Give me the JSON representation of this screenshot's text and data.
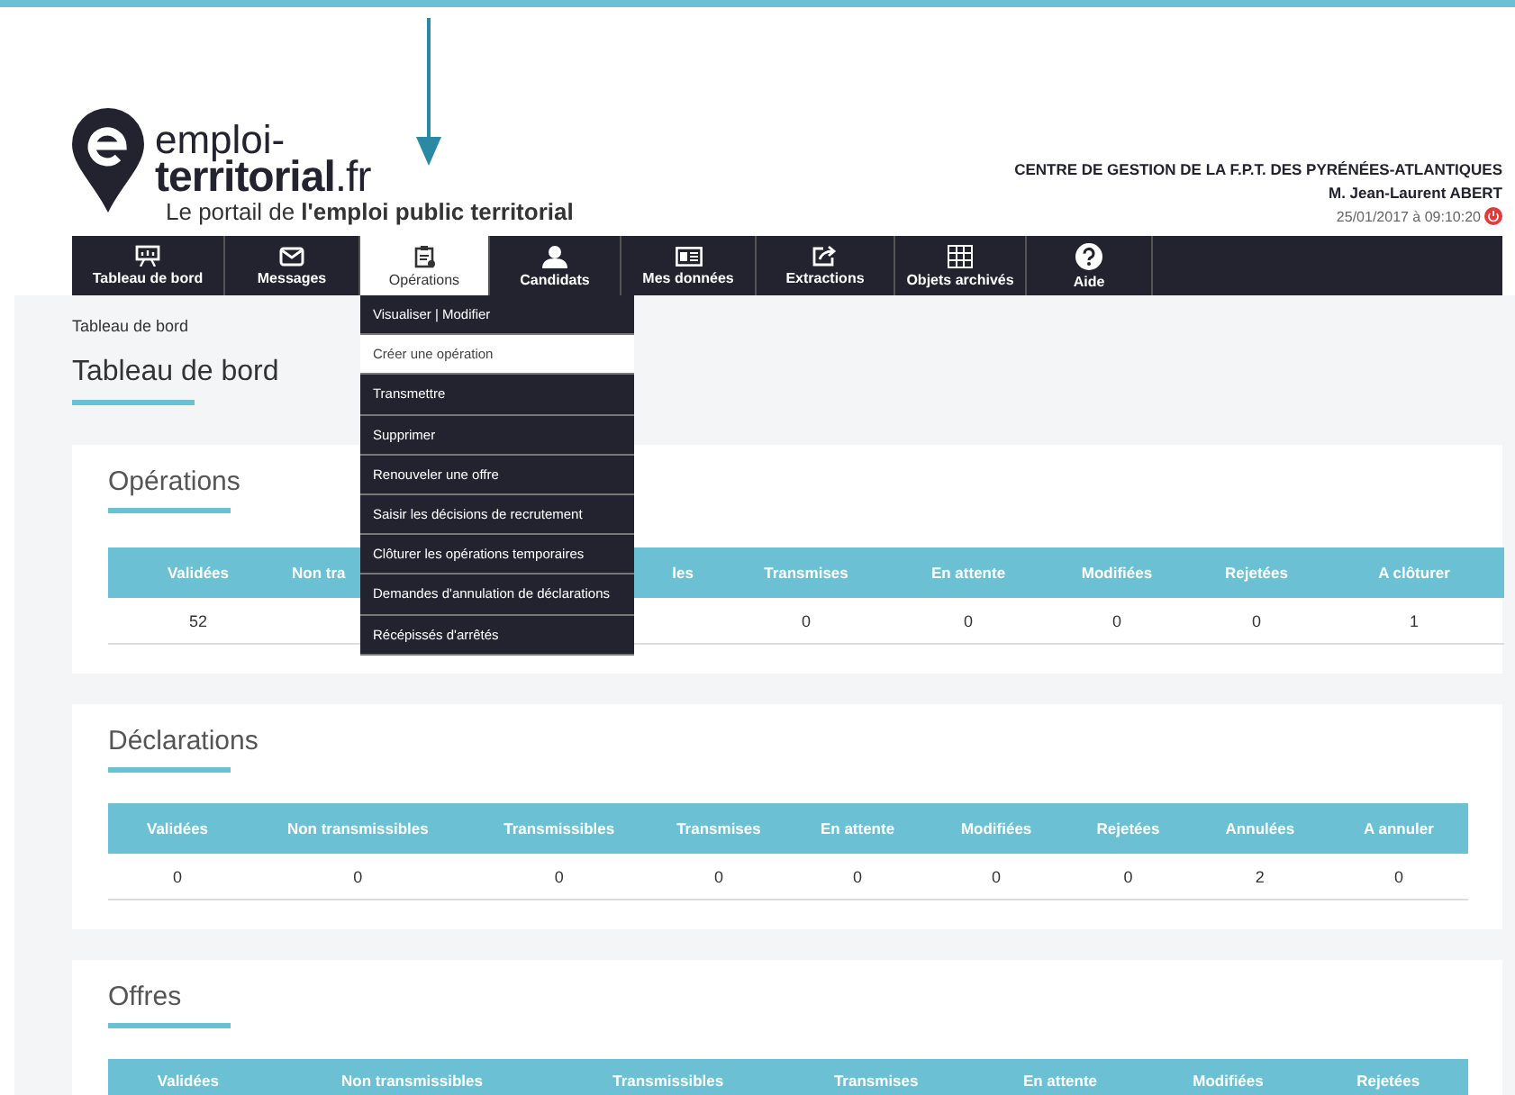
{
  "header": {
    "logo": {
      "line1": "emploi-",
      "line2": "territorial",
      "suffix": ".fr"
    },
    "tagline": "Le portail de **l'emploi public territorial**",
    "organization": "CENTRE DE GESTION DE LA F.P.T. DES PYRÉNÉES-ATLANTIQUES",
    "user": "M. Jean-Laurent ABERT",
    "datetime": "25/01/2017 à 09:10:20"
  },
  "nav": [
    {
      "label": "Tableau de bord",
      "selected": false
    },
    {
      "label": "Messages",
      "selected": false
    },
    {
      "label": "Opérations",
      "selected": true,
      "expanded": true
    },
    {
      "label": "Candidats",
      "selected": false
    },
    {
      "label": "Mes données",
      "selected": false
    },
    {
      "label": "Extractions",
      "selected": false
    },
    {
      "label": "Objets archivés",
      "selected": false
    },
    {
      "label": "Aide",
      "selected": false
    }
  ],
  "menu": [
    {
      "label": "Visualiser | Modifier",
      "selected": false
    },
    {
      "label": "Créer une opération",
      "selected": true
    },
    {
      "label": "Transmettre",
      "selected": false
    },
    {
      "label": "Supprimer",
      "selected": false
    },
    {
      "label": "Renouveler une offre",
      "selected": false
    },
    {
      "label": "Saisir les décisions de recrutement",
      "selected": false
    },
    {
      "label": "Clôturer les opérations temporaires",
      "selected": false
    },
    {
      "label": "Demandes d'annulation de déclarations",
      "selected": false
    },
    {
      "label": "Récépissés d'arrêtés",
      "selected": false
    }
  ],
  "breadcrumb": "Tableau de bord",
  "page_title": "Tableau de bord",
  "sections": [
    {
      "title": "Opérations",
      "columns": [
        {
          "label": "Validées",
          "value": "52",
          "kind": "full"
        },
        {
          "label": "Non tra",
          "kind": "cut_right"
        },
        {
          "label": "les",
          "kind": "cut_left"
        },
        {
          "label": "Transmises",
          "value": "0",
          "kind": "full"
        },
        {
          "label": "En attente",
          "value": "0",
          "kind": "full"
        },
        {
          "label": "Modifiées",
          "value": "0",
          "kind": "full"
        },
        {
          "label": "Rejetées",
          "value": "0",
          "kind": "full"
        },
        {
          "label": "A clôturer",
          "value": "1",
          "kind": "full"
        }
      ]
    },
    {
      "title": "Déclarations",
      "columns": [
        {
          "label": "Validées",
          "value": "0",
          "kind": "full"
        },
        {
          "label": "Non transmissibles",
          "value": "0",
          "kind": "full"
        },
        {
          "label": "Transmissibles",
          "value": "0",
          "kind": "full"
        },
        {
          "label": "Transmises",
          "value": "0",
          "kind": "full"
        },
        {
          "label": "En attente",
          "value": "0",
          "kind": "full"
        },
        {
          "label": "Modifiées",
          "value": "0",
          "kind": "full"
        },
        {
          "label": "Rejetées",
          "value": "0",
          "kind": "full"
        },
        {
          "label": "Annulées",
          "value": "2",
          "kind": "full"
        },
        {
          "label": "A annuler",
          "value": "0",
          "kind": "full"
        }
      ]
    },
    {
      "title": "Offres",
      "columns": [
        {
          "label": "Validées",
          "kind": "full"
        },
        {
          "label": "Non transmissibles",
          "kind": "full"
        },
        {
          "label": "Transmissibles",
          "kind": "full"
        },
        {
          "label": "Transmises",
          "kind": "full"
        },
        {
          "label": "En attente",
          "kind": "full"
        },
        {
          "label": "Modifiées",
          "kind": "full"
        },
        {
          "label": "Rejetées",
          "kind": "full"
        }
      ]
    }
  ]
}
